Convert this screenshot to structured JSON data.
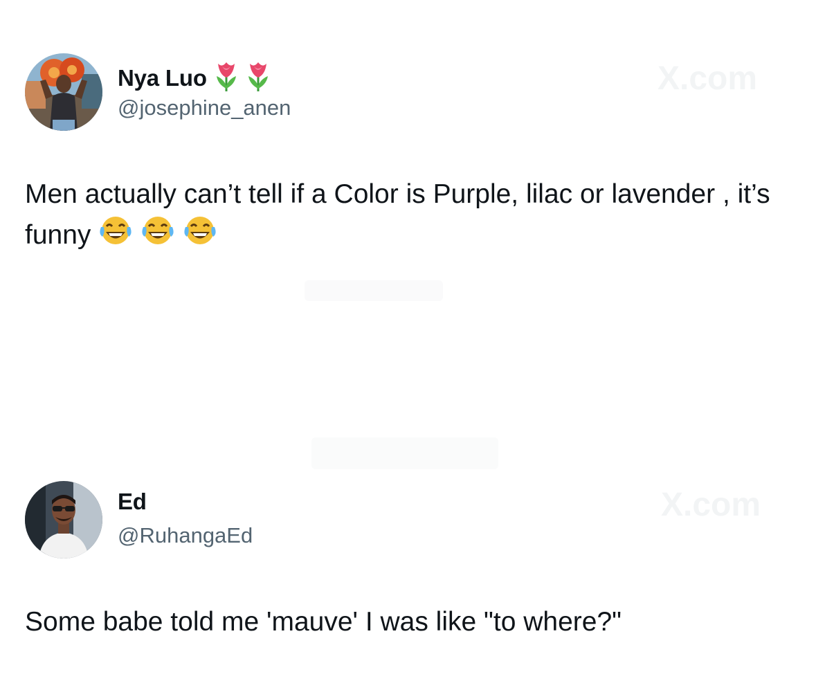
{
  "tweets": [
    {
      "author_name": "Nya Luo",
      "author_handle": "@josephine_anen",
      "name_badges": [
        "tulip-emoji",
        "tulip-emoji"
      ],
      "text": "Men actually can’t tell if a Color is Purple, lilac or lavender , it’s funny",
      "text_emojis": [
        "face-with-tears-of-joy",
        "face-with-tears-of-joy",
        "face-with-tears-of-joy"
      ],
      "watermark": "X.com"
    },
    {
      "author_name": "Ed",
      "author_handle": "@RuhangaEd",
      "text": "Some babe told me 'mauve' I was like \"to where?\"",
      "watermark": "X.com"
    }
  ],
  "colors": {
    "text": "#0f1419",
    "handle": "#536471",
    "background": "#ffffff"
  }
}
